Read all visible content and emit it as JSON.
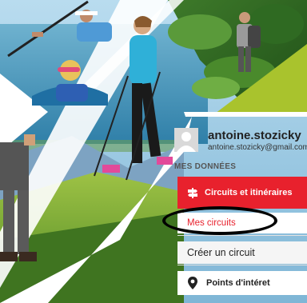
{
  "profile": {
    "username": "antoine.stozicky",
    "email": "antoine.stozicky@gmail.com"
  },
  "menu": {
    "section_label": "MES DONNÉES",
    "items": [
      {
        "label": "Circuits et itinéraires",
        "icon": "signpost-icon",
        "active": true
      },
      {
        "label": "Mes circuits",
        "submenu": true
      },
      {
        "label": "Créer un circuit",
        "submenu": true
      },
      {
        "label": "Points d'intéret",
        "icon": "map-pin-icon"
      }
    ]
  },
  "colors": {
    "accent": "#e8212d",
    "lime_banner": "#a9c32d"
  }
}
